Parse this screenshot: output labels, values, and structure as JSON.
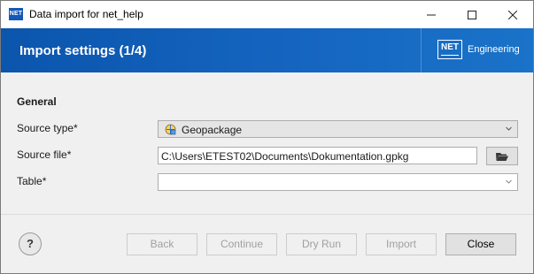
{
  "window": {
    "app_icon": "NET",
    "title": "Data import for net_help",
    "controls": [
      "minimize-icon",
      "maximize-icon",
      "close-icon"
    ]
  },
  "header": {
    "title": "Import settings (1/4)",
    "brand_logo": "NET",
    "brand_text": "Engineering",
    "colors": {
      "gradient_start": "#0b55ad",
      "gradient_end": "#1a73c8"
    }
  },
  "form": {
    "section_title": "General",
    "source_type": {
      "label": "Source type*",
      "value": "Geopackage",
      "icon": "geopackage-icon"
    },
    "source_file": {
      "label": "Source file*",
      "value": "C:\\Users\\ETEST02\\Documents\\Dokumentation.gpkg",
      "browse_icon": "folder-open-icon"
    },
    "table": {
      "label": "Table*",
      "value": ""
    }
  },
  "footer": {
    "help": "?",
    "buttons": {
      "back": "Back",
      "continue": "Continue",
      "dry_run": "Dry Run",
      "import": "Import",
      "close": "Close"
    }
  }
}
